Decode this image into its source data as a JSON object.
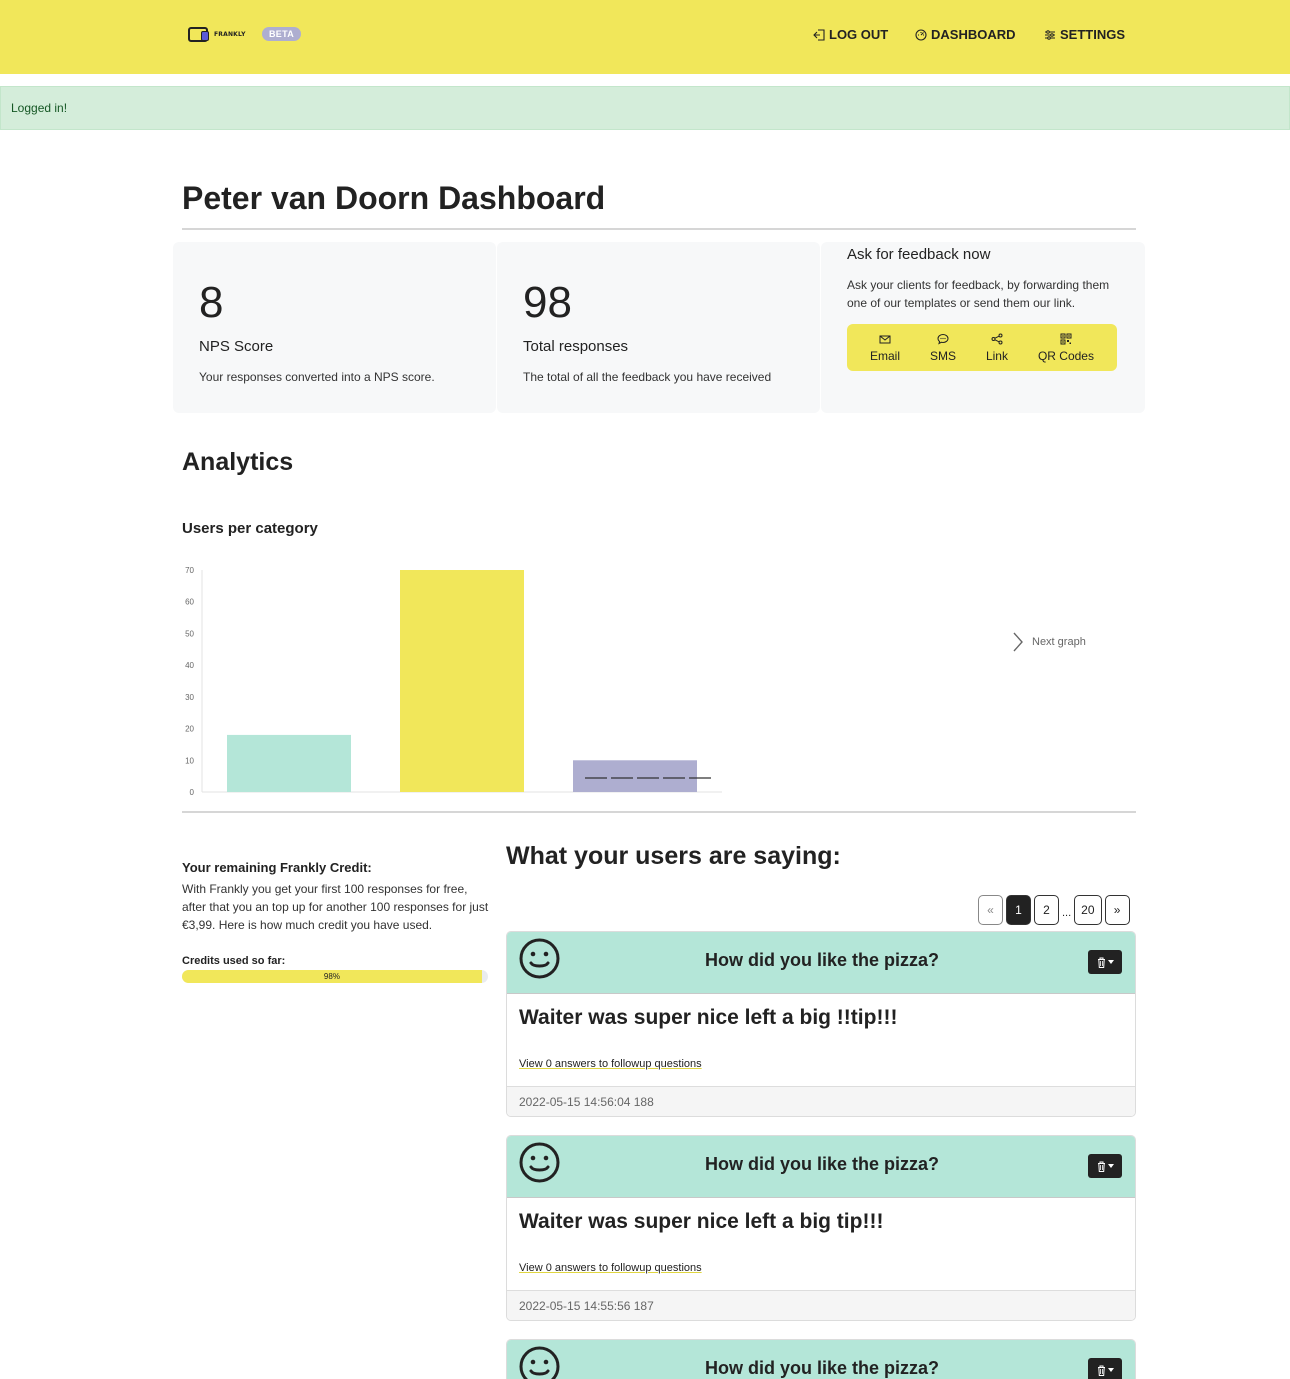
{
  "header": {
    "logo_text": "FRANKLY",
    "beta_label": "BETA",
    "nav": {
      "logout": "LOG OUT",
      "dashboard": "DASHBOARD",
      "settings": "SETTINGS"
    },
    "colors": {
      "brand": "#f1e75a"
    }
  },
  "alert": {
    "text": "Logged in!"
  },
  "page": {
    "title": "Peter van Doorn Dashboard"
  },
  "stats": {
    "nps": {
      "value": "8",
      "label": "NPS Score",
      "desc": "Your responses converted into a NPS score."
    },
    "total": {
      "value": "98",
      "label": "Total responses",
      "desc": "The total of all the feedback you have received"
    }
  },
  "ask": {
    "title": "Ask for feedback now",
    "desc": "Ask your clients for feedback, by forwarding them one of our templates or send them our link.",
    "buttons": [
      {
        "label": "Email",
        "icon": "envelope-icon"
      },
      {
        "label": "SMS",
        "icon": "chat-icon"
      },
      {
        "label": "Link",
        "icon": "share-icon"
      },
      {
        "label": "QR Codes",
        "icon": "qr-code-icon"
      }
    ]
  },
  "analytics": {
    "title": "Analytics",
    "chart_title": "Users per category",
    "next_graph": "Next graph"
  },
  "chart_data": {
    "type": "bar",
    "title": "Users per category",
    "xlabel": "",
    "ylabel": "",
    "ylim": [
      0,
      70
    ],
    "yticks": [
      0,
      10,
      20,
      30,
      40,
      50,
      60,
      70
    ],
    "categories": [
      "",
      "",
      ""
    ],
    "values": [
      18,
      70,
      10
    ],
    "colors": [
      "#b4e6d8",
      "#f1e75a",
      "#aeaed0"
    ],
    "grid": false
  },
  "credits": {
    "title": "Your remaining Frankly Credit:",
    "desc": "With Frankly you get your first 100 responses for free, after that you an top up for another 100 responses for just €3,99. Here is how much credit you have used.",
    "used_label": "Credits used so far:",
    "used_percent": 98,
    "used_text": "98%"
  },
  "responses": {
    "title": "What your users are saying:",
    "pager": {
      "prev": "«",
      "pages": [
        "1",
        "2"
      ],
      "ellipsis": "...",
      "last": "20",
      "next": "»"
    },
    "items": [
      {
        "question": "How did you like the pizza?",
        "answer": "Waiter was super nice left a big !!tip!!!",
        "link": "View 0 answers to followup questions",
        "timestamp": "2022-05-15 14:56:04 188"
      },
      {
        "question": "How did you like the pizza?",
        "answer": "Waiter was super nice left a big tip!!!",
        "link": "View 0 answers to followup questions",
        "timestamp": "2022-05-15 14:55:56 187"
      },
      {
        "question": "How did you like the pizza?",
        "answer": "",
        "link": "",
        "timestamp": ""
      }
    ]
  }
}
